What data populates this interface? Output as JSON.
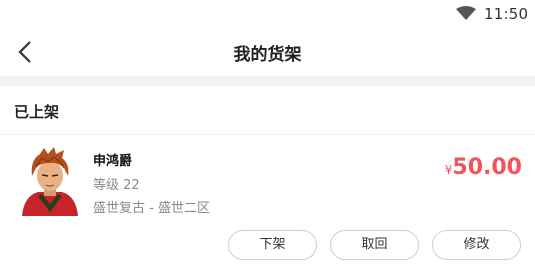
{
  "status_bar": {
    "time": "11:50",
    "icon": "wifi-icon"
  },
  "header": {
    "title": "我的货架",
    "back_icon": "back-arrow-icon"
  },
  "section": {
    "title": "已上架"
  },
  "listing": {
    "avatar_icon": "character-portrait",
    "name": "申鸿爵",
    "level": "等级 22",
    "server": "盛世复古 - 盛世二区",
    "currency": "¥",
    "price": "50.00",
    "price_color": "#f2545b",
    "actions": {
      "delist": "下架",
      "retrieve": "取回",
      "edit": "修改"
    }
  }
}
